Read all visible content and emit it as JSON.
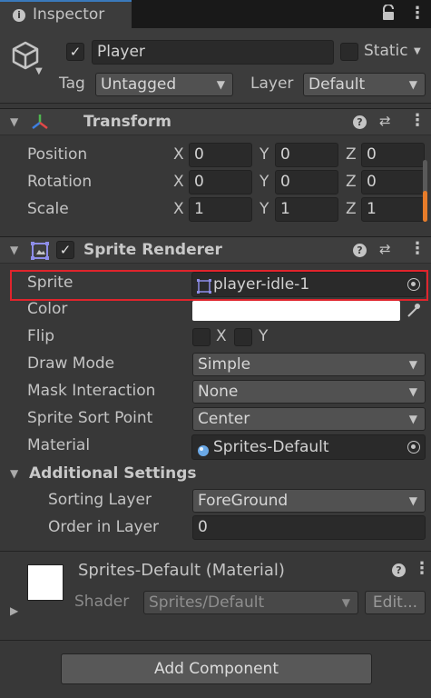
{
  "tab": {
    "label": "Inspector"
  },
  "header": {
    "name_value": "Player",
    "static_label": "Static",
    "tag_label": "Tag",
    "tag_value": "Untagged",
    "layer_label": "Layer",
    "layer_value": "Default"
  },
  "transform": {
    "title": "Transform",
    "rows": [
      {
        "label": "Position",
        "x": "0",
        "y": "0",
        "z": "0"
      },
      {
        "label": "Rotation",
        "x": "0",
        "y": "0",
        "z": "0"
      },
      {
        "label": "Scale",
        "x": "1",
        "y": "1",
        "z": "1"
      }
    ],
    "axes": [
      "X",
      "Y",
      "Z"
    ]
  },
  "sprite_renderer": {
    "title": "Sprite Renderer",
    "sprite_label": "Sprite",
    "sprite_value": "player-idle-1",
    "color_label": "Color",
    "color_value": "#ffffff",
    "flip_label": "Flip",
    "flip_x": "X",
    "flip_y": "Y",
    "draw_mode_label": "Draw Mode",
    "draw_mode_value": "Simple",
    "mask_label": "Mask Interaction",
    "mask_value": "None",
    "sort_point_label": "Sprite Sort Point",
    "sort_point_value": "Center",
    "material_label": "Material",
    "material_value": "Sprites-Default",
    "additional_title": "Additional Settings",
    "sorting_layer_label": "Sorting Layer",
    "sorting_layer_value": "ForeGround",
    "order_label": "Order in Layer",
    "order_value": "0"
  },
  "material": {
    "title": "Sprites-Default (Material)",
    "shader_label": "Shader",
    "shader_value": "Sprites/Default",
    "edit_label": "Edit..."
  },
  "add_component_label": "Add Component",
  "colors": {
    "highlight": "#e0242c",
    "accent": "#3a79bb"
  }
}
